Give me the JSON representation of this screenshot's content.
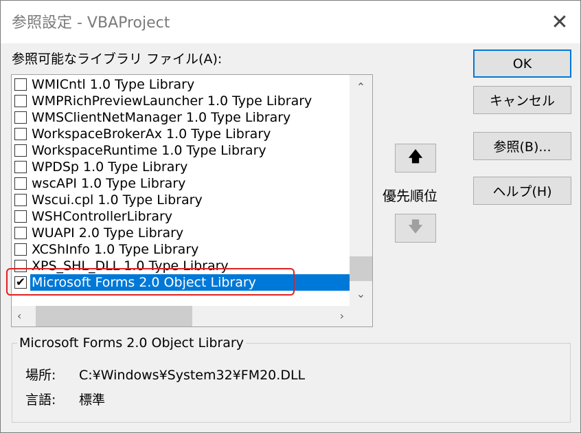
{
  "window": {
    "title": "参照設定 - VBAProject",
    "close_glyph": "✕"
  },
  "list": {
    "label": "参照可能なライブラリ ファイル(A):",
    "items": [
      {
        "label": "WMICntl 1.0 Type Library",
        "checked": false
      },
      {
        "label": "WMPRichPreviewLauncher 1.0 Type Library",
        "checked": false
      },
      {
        "label": "WMSClientNetManager 1.0 Type Library",
        "checked": false
      },
      {
        "label": "WorkspaceBrokerAx 1.0 Type Library",
        "checked": false
      },
      {
        "label": "WorkspaceRuntime 1.0 Type Library",
        "checked": false
      },
      {
        "label": "WPDSp 1.0 Type Library",
        "checked": false
      },
      {
        "label": "wscAPI 1.0 Type Library",
        "checked": false
      },
      {
        "label": "Wscui.cpl 1.0 Type Library",
        "checked": false
      },
      {
        "label": "WSHControllerLibrary",
        "checked": false
      },
      {
        "label": "WUAPI 2.0 Type Library",
        "checked": false
      },
      {
        "label": "XCShInfo 1.0 Type Library",
        "checked": false
      },
      {
        "label": "XPS_SHL_DLL 1.0 Type Library",
        "checked": false
      },
      {
        "label": "Microsoft Forms 2.0 Object Library",
        "checked": true,
        "selected": true
      }
    ],
    "check_glyph": "✔"
  },
  "buttons": {
    "ok": "OK",
    "cancel": "キャンセル",
    "browse": "参照(B)...",
    "help": "ヘルプ(H)"
  },
  "priority": {
    "label": "優先順位",
    "up_glyph": "🡅",
    "down_glyph": "🡇"
  },
  "scroll": {
    "up": "⌃",
    "down": "⌄",
    "left": "‹",
    "right": "›"
  },
  "details": {
    "title": "Microsoft Forms 2.0 Object Library",
    "location_label": "場所:",
    "location_value": "C:¥Windows¥System32¥FM20.DLL",
    "language_label": "言語:",
    "language_value": "標準"
  },
  "colors": {
    "selection": "#0078d7",
    "annotation": "#e02020"
  }
}
